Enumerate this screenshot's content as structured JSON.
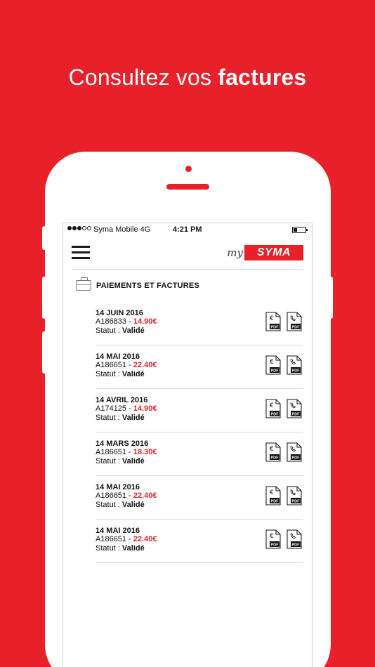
{
  "headline": {
    "regular": "Consultez vos",
    "bold": "factures"
  },
  "status_bar": {
    "carrier": "Syma Mobile 4G",
    "time": "4:21 PM"
  },
  "app": {
    "logo_my": "my",
    "logo_brand": "SYMA"
  },
  "section": {
    "title": "PAIEMENTS ET FACTURES"
  },
  "invoices": [
    {
      "date": "14 JUIN 2016",
      "ref": "A186833",
      "sep": " - ",
      "amount": "14.90€",
      "status_label": "Statut :",
      "status": "Validé"
    },
    {
      "date": "14 MAI 2016",
      "ref": "A186651",
      "sep": " - ",
      "amount": "22.40€",
      "status_label": "Statut :",
      "status": "Validé"
    },
    {
      "date": "14 AVRIL 2016",
      "ref": "A174125",
      "sep": " - ",
      "amount": "14.90€",
      "status_label": "Statut :",
      "status": "Validé"
    },
    {
      "date": "14 MARS 2016",
      "ref": "A186651",
      "sep": " - ",
      "amount": "18.30€",
      "status_label": "Statut :",
      "status": "Validé"
    },
    {
      "date": "14 MAI 2016",
      "ref": "A186651",
      "sep": " - ",
      "amount": "22.40€",
      "status_label": "Statut :",
      "status": "Validé"
    },
    {
      "date": "14 MAI 2016",
      "ref": "A186651",
      "sep": " - ",
      "amount": "22.40€",
      "status_label": "Statut :",
      "status": "Validé"
    }
  ],
  "icons": {
    "pdf_label": "PDF",
    "euro_symbol": "€",
    "invoice_icon": "euro-pdf-icon",
    "call_detail_icon": "phone-pdf-icon"
  },
  "colors": {
    "brand": "#e8202a",
    "text": "#111111",
    "divider": "#d9d9d9"
  }
}
